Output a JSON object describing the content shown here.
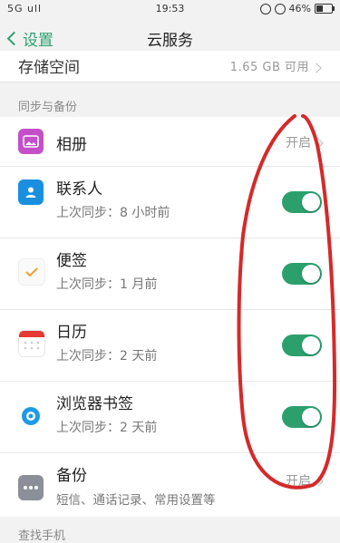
{
  "status_bar": {
    "signal": "5G ull",
    "time": "19:53",
    "battery_percent": "46%",
    "battery_level": 0.46
  },
  "nav": {
    "back_label": "设置",
    "title": "云服务"
  },
  "storage": {
    "label": "存储空间",
    "value": "1.65 GB 可用"
  },
  "sections": {
    "sync_backup": "同步与备份",
    "find_phone": "查找手机"
  },
  "items": [
    {
      "title": "相册",
      "status": "开启",
      "icon": "photo-album-icon"
    },
    {
      "title": "联系人",
      "subtitle": "上次同步：8 小时前",
      "toggle_on": true,
      "icon": "contacts-icon"
    },
    {
      "title": "便签",
      "subtitle": "上次同步：1 月前",
      "toggle_on": true,
      "icon": "notes-icon"
    },
    {
      "title": "日历",
      "subtitle": "上次同步：2 天前",
      "toggle_on": true,
      "icon": "calendar-icon"
    },
    {
      "title": "浏览器书签",
      "subtitle": "上次同步：2 天前",
      "toggle_on": true,
      "icon": "browser-icon"
    },
    {
      "title": "备份",
      "subtitle": "短信、通话记录、常用设置等",
      "status": "开启",
      "icon": "backup-icon"
    }
  ],
  "colors": {
    "accent": "#2ba06d",
    "annotation": "#d42a2a"
  }
}
